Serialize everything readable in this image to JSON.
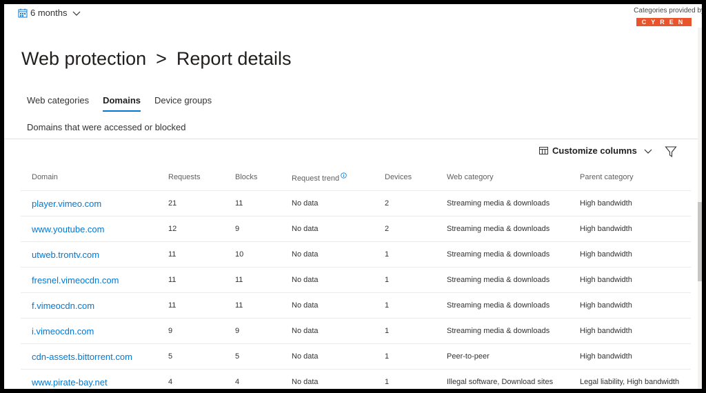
{
  "header": {
    "period_label": "6 months",
    "categories_caption": "Categories provided by",
    "vendor_logo_text": "CYREN"
  },
  "title": {
    "section": "Web protection",
    "separator": ">",
    "page": "Report details"
  },
  "tabs": [
    {
      "label": "Web categories",
      "active": false
    },
    {
      "label": "Domains",
      "active": true
    },
    {
      "label": "Device groups",
      "active": false
    }
  ],
  "subtitle": "Domains that were accessed or blocked",
  "toolbar": {
    "customize_label": "Customize columns"
  },
  "table": {
    "columns": [
      "Domain",
      "Requests",
      "Blocks",
      "Request trend",
      "Devices",
      "Web category",
      "Parent category"
    ],
    "rows": [
      {
        "domain": "player.vimeo.com",
        "requests": "21",
        "blocks": "11",
        "trend": "No data",
        "devices": "2",
        "web_category": "Streaming media & downloads",
        "parent_category": "High bandwidth"
      },
      {
        "domain": "www.youtube.com",
        "requests": "12",
        "blocks": "9",
        "trend": "No data",
        "devices": "2",
        "web_category": "Streaming media & downloads",
        "parent_category": "High bandwidth"
      },
      {
        "domain": "utweb.trontv.com",
        "requests": "11",
        "blocks": "10",
        "trend": "No data",
        "devices": "1",
        "web_category": "Streaming media & downloads",
        "parent_category": "High bandwidth"
      },
      {
        "domain": "fresnel.vimeocdn.com",
        "requests": "11",
        "blocks": "11",
        "trend": "No data",
        "devices": "1",
        "web_category": "Streaming media & downloads",
        "parent_category": "High bandwidth"
      },
      {
        "domain": "f.vimeocdn.com",
        "requests": "11",
        "blocks": "11",
        "trend": "No data",
        "devices": "1",
        "web_category": "Streaming media & downloads",
        "parent_category": "High bandwidth"
      },
      {
        "domain": "i.vimeocdn.com",
        "requests": "9",
        "blocks": "9",
        "trend": "No data",
        "devices": "1",
        "web_category": "Streaming media & downloads",
        "parent_category": "High bandwidth"
      },
      {
        "domain": "cdn-assets.bittorrent.com",
        "requests": "5",
        "blocks": "5",
        "trend": "No data",
        "devices": "1",
        "web_category": "Peer-to-peer",
        "parent_category": "High bandwidth"
      },
      {
        "domain": "www.pirate-bay.net",
        "requests": "4",
        "blocks": "4",
        "trend": "No data",
        "devices": "1",
        "web_category": "Illegal software, Download sites",
        "parent_category": "Legal liability, High bandwidth"
      }
    ]
  },
  "colors": {
    "accent": "#0078d4",
    "vendor_logo": "#e8542c"
  }
}
